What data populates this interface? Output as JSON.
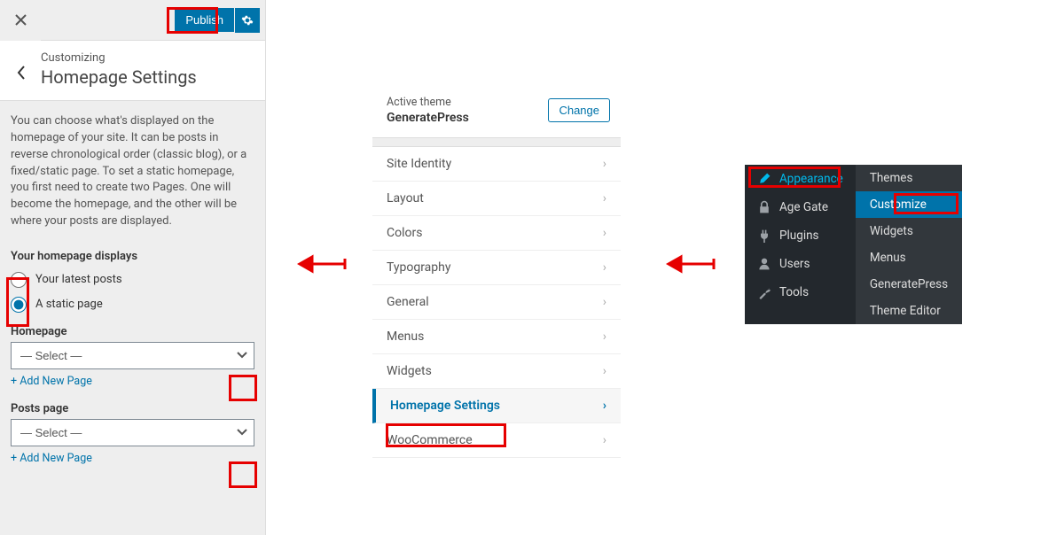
{
  "customizer": {
    "publish": "Publish",
    "eyebrow": "Customizing",
    "title": "Homepage Settings",
    "description": "You can choose what's displayed on the homepage of your site. It can be posts in reverse chronological order (classic blog), or a fixed/static page. To set a static homepage, you first need to create two Pages. One will become the homepage, and the other will be where your posts are displayed.",
    "displays_heading": "Your homepage displays",
    "radio_latest": "Your latest posts",
    "radio_static": "A static page",
    "homepage_label": "Homepage",
    "posts_page_label": "Posts page",
    "select_placeholder": "— Select —",
    "add_new_page": "+ Add New Page"
  },
  "themePanel": {
    "active_theme_label": "Active theme",
    "theme_name": "GeneratePress",
    "change": "Change",
    "items": [
      {
        "label": "Site Identity",
        "active": false
      },
      {
        "label": "Layout",
        "active": false
      },
      {
        "label": "Colors",
        "active": false
      },
      {
        "label": "Typography",
        "active": false
      },
      {
        "label": "General",
        "active": false
      },
      {
        "label": "Menus",
        "active": false
      },
      {
        "label": "Widgets",
        "active": false
      },
      {
        "label": "Homepage Settings",
        "active": true
      },
      {
        "label": "WooCommerce",
        "active": false
      }
    ]
  },
  "adminMenu": {
    "main": [
      {
        "icon": "brush",
        "label": "Appearance",
        "highlight": true
      },
      {
        "icon": "lock",
        "label": "Age Gate"
      },
      {
        "icon": "plug",
        "label": "Plugins"
      },
      {
        "icon": "users",
        "label": "Users"
      },
      {
        "icon": "wrench",
        "label": "Tools"
      }
    ],
    "sub": [
      {
        "label": "Themes"
      },
      {
        "label": "Customize",
        "selected": true
      },
      {
        "label": "Widgets"
      },
      {
        "label": "Menus"
      },
      {
        "label": "GeneratePress"
      },
      {
        "label": "Theme Editor"
      }
    ]
  }
}
